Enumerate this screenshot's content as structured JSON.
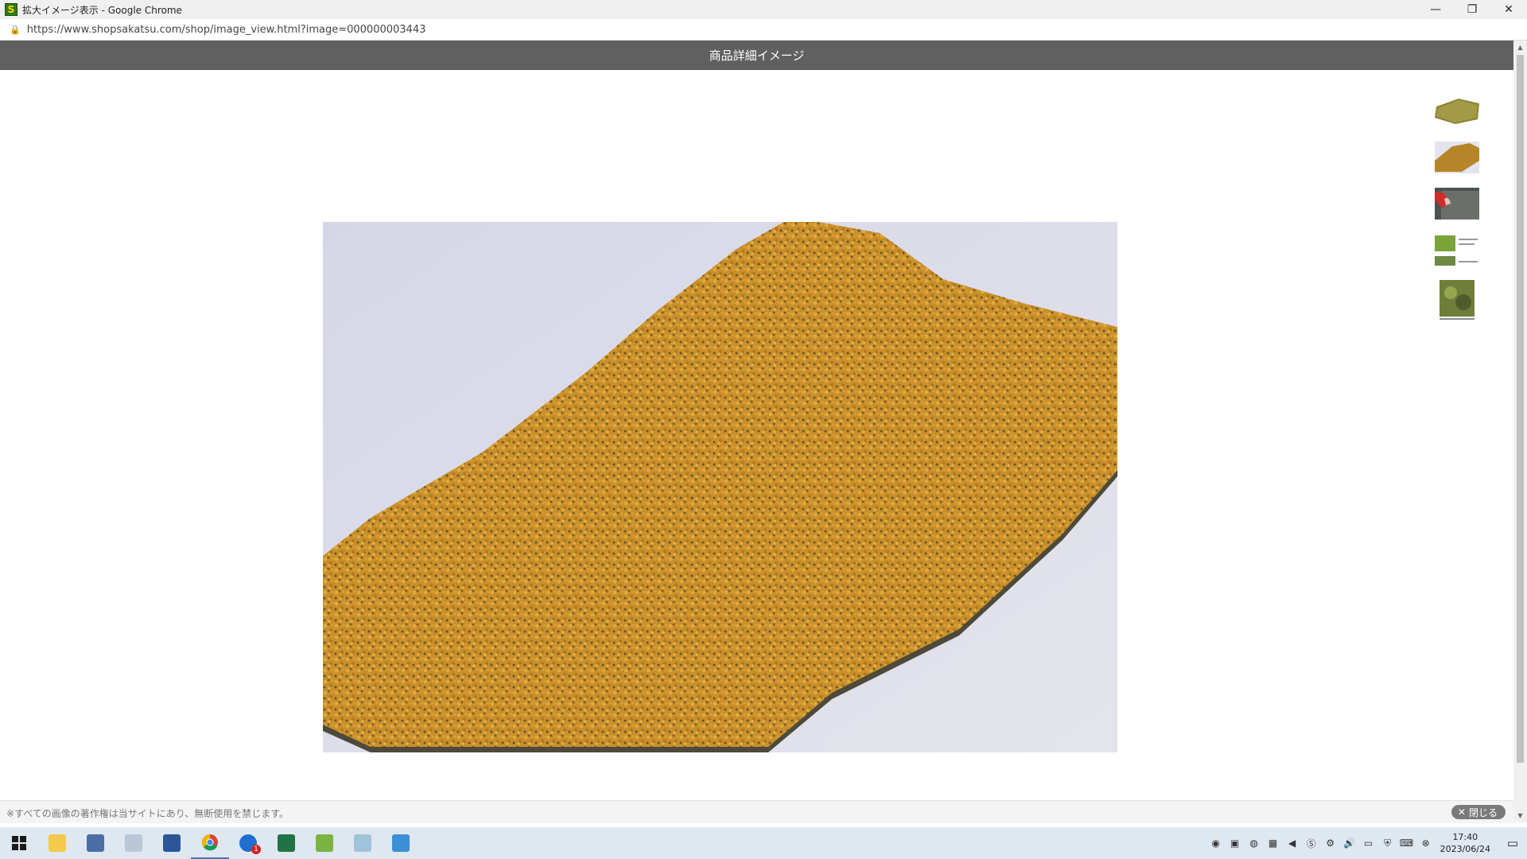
{
  "window": {
    "title": "拡大イメージ表示 - Google Chrome",
    "favicon_letter": "S",
    "controls": {
      "minimize": "—",
      "restore": "❐",
      "close": "✕"
    }
  },
  "address_bar": {
    "url": "https://www.shopsakatsu.com/shop/image_view.html?image=000000003443"
  },
  "page": {
    "header_title": "商品詳細イメージ",
    "main_image": {
      "description_icon": "grass-mat-photo-icon"
    },
    "thumbnails": [
      {
        "name": "thumbnail-1",
        "icon": "grass-mat-olive-icon"
      },
      {
        "name": "thumbnail-2",
        "icon": "grass-mat-yellow-icon"
      },
      {
        "name": "thumbnail-3",
        "icon": "grass-mat-hand-icon"
      },
      {
        "name": "thumbnail-4",
        "icon": "instructions-icon"
      },
      {
        "name": "thumbnail-5",
        "icon": "diorama-icon"
      }
    ],
    "footer": {
      "copyright": "※すべての画像の著作権は当サイトにあり、無断使用を禁じます。",
      "close_label": "閉じる",
      "close_icon": "✕"
    }
  },
  "taskbar": {
    "apps": [
      "windows-start-icon",
      "file-explorer-icon",
      "calculator-icon",
      "paint-icon",
      "word-icon",
      "chrome-icon",
      "thunderbird-icon",
      "excel-icon",
      "app-icon",
      "notes-icon",
      "remote-desktop-icon"
    ],
    "clock_time": "17:40",
    "clock_date": "2023/06/24",
    "mail_badge": "1"
  }
}
